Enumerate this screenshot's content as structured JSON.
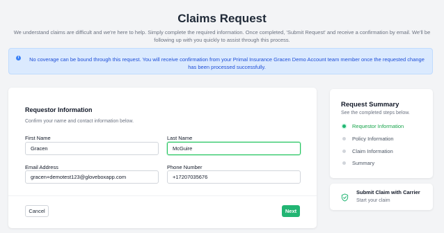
{
  "page": {
    "title": "Claims Request",
    "subtitle": "We understand claims are difficult and we're here to help. Simply complete the required information. Once completed, 'Submit Request' and receive a confirmation by email. We'll be following up with you quickly to assist through this process."
  },
  "banner": {
    "icon": "info-icon",
    "text": "No coverage can be bound through this request. You will receive confirmation from your Primal Insurance Gracen Demo Account team member once the requested change has been processed successfully."
  },
  "form": {
    "section_title": "Requestor Information",
    "section_subtitle": "Confirm your name and contact information below.",
    "first_name": {
      "label": "First Name",
      "value": "Gracen"
    },
    "last_name": {
      "label": "Last Name",
      "value": "McGuire"
    },
    "email": {
      "label": "Email Address",
      "value": "gracen+demotest123@gloveboxapp.com"
    },
    "phone": {
      "label": "Phone Number",
      "value": "+17207035676"
    },
    "cancel_label": "Cancel",
    "next_label": "Next"
  },
  "summary": {
    "title": "Request Summary",
    "subtitle": "See the completed steps below.",
    "steps": [
      {
        "label": "Requestor Information",
        "active": true
      },
      {
        "label": "Policy Information",
        "active": false
      },
      {
        "label": "Claim Information",
        "active": false
      },
      {
        "label": "Summary",
        "active": false
      }
    ]
  },
  "submit": {
    "icon": "shield-check-icon",
    "title": "Submit Claim with Carrier",
    "subtitle": "Start your claim"
  },
  "colors": {
    "accent": "#22b573",
    "banner_bg": "#dbeafe",
    "banner_text": "#1d4ed8"
  }
}
